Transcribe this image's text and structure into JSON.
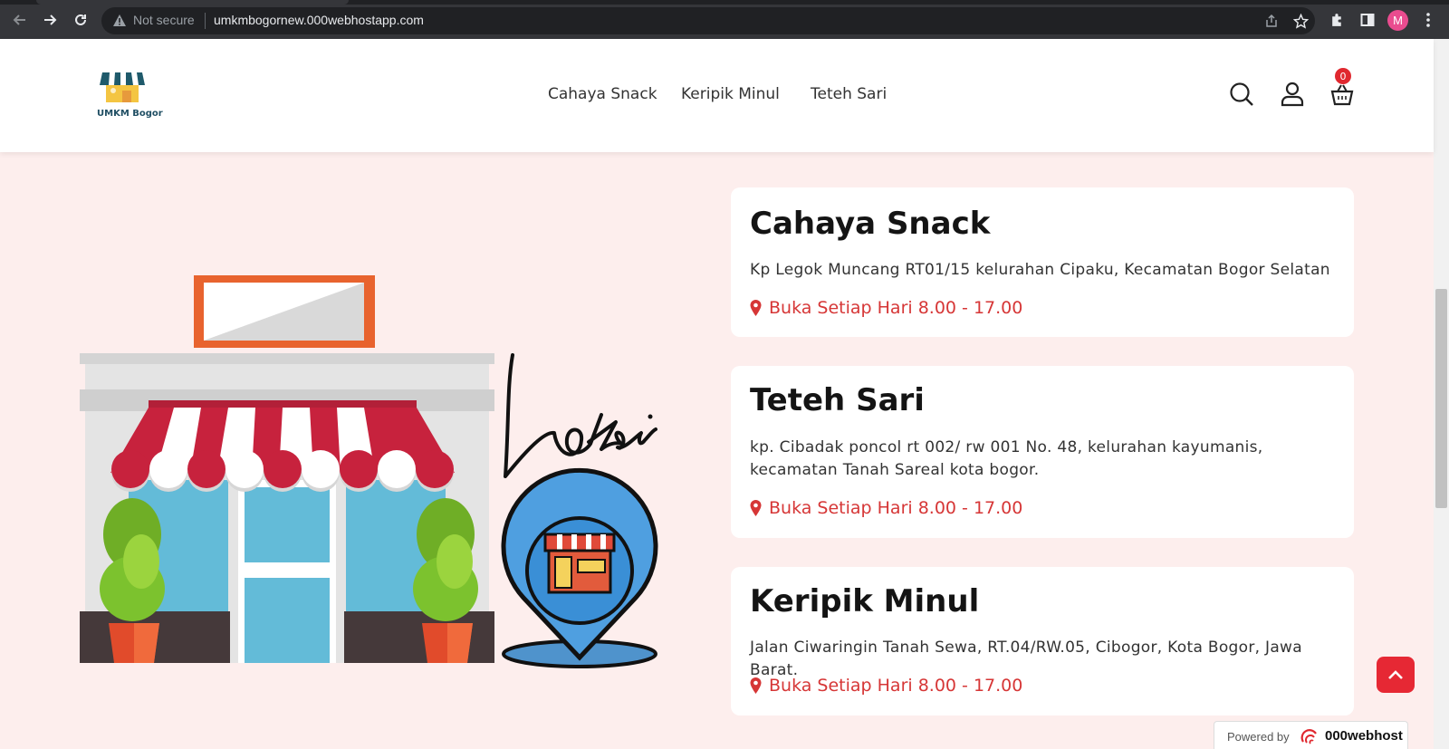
{
  "browser": {
    "security_label": "Not secure",
    "url": "umkmbogornew.000webhostapp.com",
    "profile_initial": "M",
    "icons": [
      "back-icon",
      "forward-icon",
      "reload-icon",
      "warning-icon",
      "share-icon",
      "star-icon",
      "extensions-icon",
      "side-panel-icon",
      "menu-icon"
    ]
  },
  "header": {
    "logo_text": "UMKM Bogor",
    "menu": [
      "Cahaya Snack",
      "Keripik Minul",
      "Teteh Sari"
    ],
    "cart_count": "0",
    "icons": [
      "search-icon",
      "user-icon",
      "cart-icon"
    ]
  },
  "illustration": {
    "word": "Lokasi"
  },
  "stores": [
    {
      "name": "Cahaya Snack",
      "address": "Kp Legok Muncang RT01/15 kelurahan Cipaku, Kecamatan Bogor Selatan",
      "hours": "Buka Setiap Hari 8.00 - 17.00"
    },
    {
      "name": "Teteh Sari",
      "address": "kp. Cibadak poncol rt 002/ rw 001 No. 48, kelurahan kayumanis, kecamatan Tanah Sareal kota bogor.",
      "hours": "Buka Setiap Hari 8.00 - 17.00"
    },
    {
      "name": "Keripik Minul",
      "address": "Jalan Ciwaringin Tanah Sewa, RT.04/RW.05, Cibogor, Kota Bogor, Jawa Barat.",
      "hours": "Buka Setiap Hari 8.00 - 17.00"
    }
  ],
  "footer": {
    "powered_by": "Powered by",
    "brand": "000webhost"
  },
  "colors": {
    "accent": "#d63636",
    "background": "#fdeeed",
    "button": "#e62834"
  }
}
